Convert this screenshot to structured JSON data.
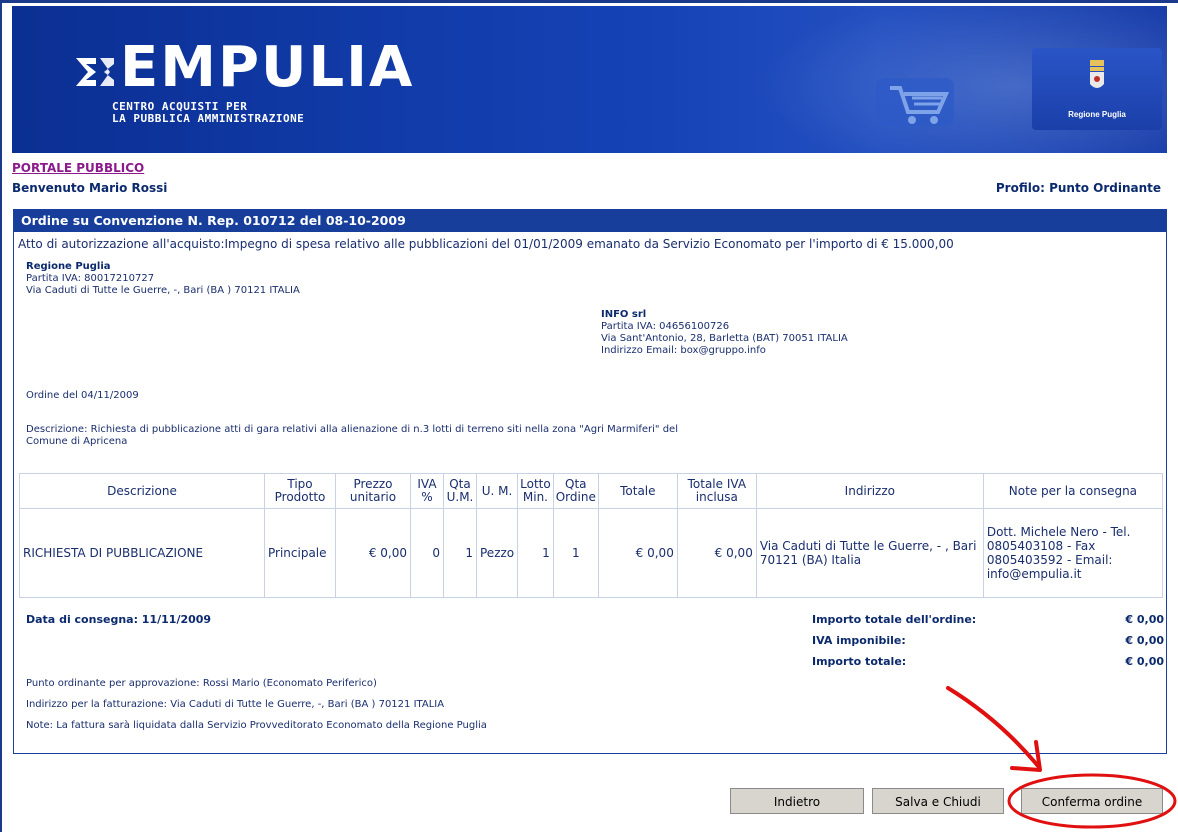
{
  "header": {
    "logo_text": "EMPULIA",
    "logo_sub1": "CENTRO ACQUISTI PER",
    "logo_sub2": "LA PUBBLICA AMMINISTRAZIONE",
    "region_label": "Regione Puglia"
  },
  "nav": {
    "portal_link": "PORTALE PUBBLICO",
    "welcome": "Benvenuto Mario Rossi",
    "profile": "Profilo: Punto Ordinante"
  },
  "order": {
    "title": "Ordine su Convenzione N. Rep. 010712 del 08-10-2009",
    "authorization": "Atto di autorizzazione all'acquisto:Impegno di spesa relativo alle pubblicazioni del 01/01/2009 emanato da Servizio Economato per l'importo di € 15.000,00",
    "buyer": {
      "name": "Regione Puglia",
      "vat": "Partita IVA: 80017210727",
      "address": "Via Caduti di Tutte le Guerre, -, Bari (BA ) 70121 ITALIA"
    },
    "supplier": {
      "name": "INFO srl",
      "vat": "Partita IVA: 04656100726",
      "address": "Via Sant'Antonio, 28, Barletta (BAT) 70051 ITALIA",
      "email": "Indirizzo Email: box@gruppo.info"
    },
    "order_date": "Ordine del 04/11/2009",
    "description_line1": "Descrizione: Richiesta di pubblicazione atti di gara relativi alla alienazione di n.3 lotti di terreno siti nella zona \"Agri Marmiferi\" del",
    "description_line2": "Comune di Apricena"
  },
  "table": {
    "headers": {
      "descr": "Descrizione",
      "tipo1": "Tipo",
      "tipo2": "Prodotto",
      "prezzo1": "Prezzo",
      "prezzo2": "unitario",
      "iva1": "IVA",
      "iva2": "%",
      "qtaum1": "Qta",
      "qtaum2": "U.M.",
      "um": "U. M.",
      "lotto1": "Lotto",
      "lotto2": "Min.",
      "qtaord1": "Qta",
      "qtaord2": "Ordine",
      "totale": "Totale",
      "totiva1": "Totale IVA",
      "totiva2": "inclusa",
      "indirizzo": "Indirizzo",
      "note": "Note per la consegna"
    },
    "row": {
      "descr": "RICHIESTA DI PUBBLICAZIONE",
      "tipo": "Principale",
      "prezzo": "€ 0,00",
      "iva": "0",
      "qta_um": "1",
      "um": "Pezzo",
      "lotto": "1",
      "qta_ord": "1",
      "totale": "€ 0,00",
      "tot_iva": "€ 0,00",
      "indirizzo": "Via Caduti di Tutte le Guerre, - , Bari 70121 (BA) Italia",
      "note": "Dott. Michele Nero - Tel. 0805403108 - Fax 0805403592 - Email: info@empulia.it"
    }
  },
  "summary": {
    "delivery": "Data di consegna: 11/11/2009",
    "total_label": "Importo totale dell'ordine:",
    "total_value": "€ 0,00",
    "iva_label": "IVA imponibile:",
    "iva_value": "€ 0,00",
    "grand_label": "Importo totale:",
    "grand_value": "€ 0,00",
    "approver": "Punto ordinante per approvazione: Rossi Mario (Economato Periferico)",
    "billing": "Indirizzo per la fatturazione: Via Caduti di Tutte le Guerre, -, Bari (BA ) 70121 ITALIA",
    "notes": "Note: La fattura sarà liquidata dalla Servizio Provveditorato Economato della Regione Puglia"
  },
  "buttons": {
    "back": "Indietro",
    "save_close": "Salva e Chiudi",
    "confirm": "Conferma ordine"
  },
  "colors": {
    "banner": "#1543b6",
    "panel_header": "#163e9a",
    "annotation": "#e01010"
  }
}
